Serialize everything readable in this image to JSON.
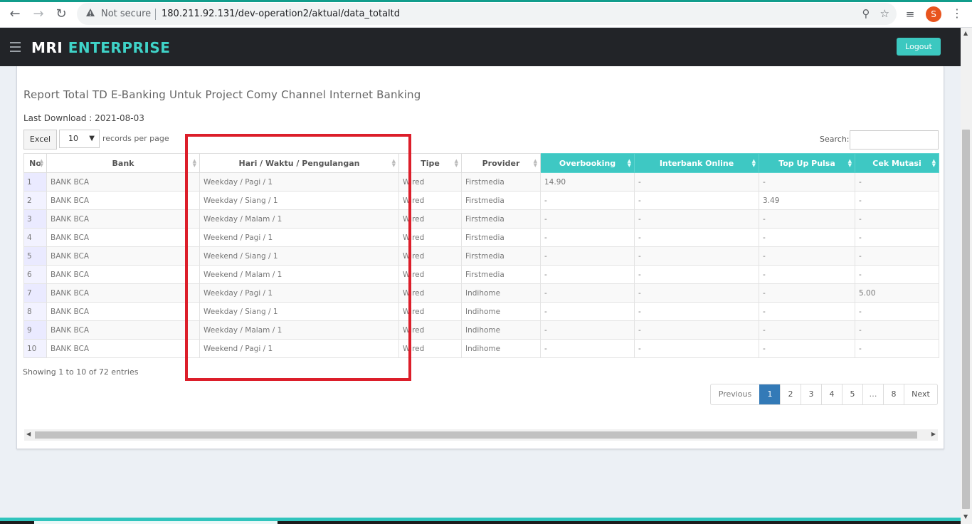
{
  "browser": {
    "security_label": "Not secure",
    "url": "180.211.92.131/dev-operation2/aktual/data_totaltd",
    "profile_initial": "S"
  },
  "header": {
    "brand_part1": "MRI",
    "brand_part2": "ENTERPRISE",
    "logout_label": "Logout"
  },
  "report": {
    "title": "Report Total TD E-Banking Untuk Project Comy Channel Internet Banking",
    "last_download": "Last Download : 2021-08-03",
    "excel_label": "Excel",
    "page_length": "10",
    "length_label": "records per page",
    "search_label": "Search:",
    "search_value": ""
  },
  "table": {
    "columns": [
      "No",
      "Bank",
      "Hari / Waktu / Pengulangan",
      "Tipe",
      "Provider",
      "Overbooking",
      "Interbank Online",
      "Top Up Pulsa",
      "Cek Mutasi"
    ],
    "rows": [
      [
        "1",
        "BANK BCA",
        "Weekday / Pagi / 1",
        "Wired",
        "Firstmedia",
        "14.90",
        "-",
        "-",
        "-"
      ],
      [
        "2",
        "BANK BCA",
        "Weekday / Siang / 1",
        "Wired",
        "Firstmedia",
        "-",
        "-",
        "3.49",
        "-"
      ],
      [
        "3",
        "BANK BCA",
        "Weekday / Malam / 1",
        "Wired",
        "Firstmedia",
        "-",
        "-",
        "-",
        "-"
      ],
      [
        "4",
        "BANK BCA",
        "Weekend / Pagi / 1",
        "Wired",
        "Firstmedia",
        "-",
        "-",
        "-",
        "-"
      ],
      [
        "5",
        "BANK BCA",
        "Weekend / Siang / 1",
        "Wired",
        "Firstmedia",
        "-",
        "-",
        "-",
        "-"
      ],
      [
        "6",
        "BANK BCA",
        "Weekend / Malam / 1",
        "Wired",
        "Firstmedia",
        "-",
        "-",
        "-",
        "-"
      ],
      [
        "7",
        "BANK BCA",
        "Weekday / Pagi / 1",
        "Wired",
        "Indihome",
        "-",
        "-",
        "-",
        "5.00"
      ],
      [
        "8",
        "BANK BCA",
        "Weekday / Siang / 1",
        "Wired",
        "Indihome",
        "-",
        "-",
        "-",
        "-"
      ],
      [
        "9",
        "BANK BCA",
        "Weekday / Malam / 1",
        "Wired",
        "Indihome",
        "-",
        "-",
        "-",
        "-"
      ],
      [
        "10",
        "BANK BCA",
        "Weekend / Pagi / 1",
        "Wired",
        "Indihome",
        "-",
        "-",
        "-",
        "-"
      ]
    ],
    "info": "Showing 1 to 10 of 72 entries"
  },
  "pagination": {
    "previous": "Previous",
    "pages": [
      "1",
      "2",
      "3",
      "4",
      "5",
      "…",
      "8"
    ],
    "active": "1",
    "next": "Next"
  },
  "colors": {
    "accent": "#3ec8c3",
    "header_bg": "#222428",
    "highlight": "#dc1e2a",
    "pager_active": "#337ab7"
  }
}
